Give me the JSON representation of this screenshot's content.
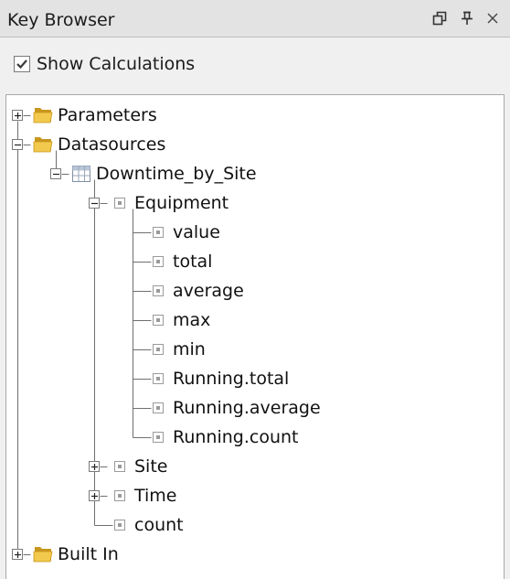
{
  "panel": {
    "title": "Key Browser",
    "controls": [
      "restore-icon",
      "pin-icon",
      "close-icon"
    ]
  },
  "options": {
    "show_calculations_label": "Show Calculations",
    "show_calculations_checked": true
  },
  "tree": [
    {
      "label": "Parameters",
      "depth": 0,
      "kind": "folder",
      "toggle": "plus"
    },
    {
      "label": "Datasources",
      "depth": 0,
      "kind": "folder",
      "toggle": "minus"
    },
    {
      "label": "Downtime_by_Site",
      "depth": 1,
      "kind": "table",
      "toggle": "minus"
    },
    {
      "label": "Equipment",
      "depth": 2,
      "kind": "field",
      "toggle": "minus"
    },
    {
      "label": "value",
      "depth": 3,
      "kind": "field",
      "toggle": "none"
    },
    {
      "label": "total",
      "depth": 3,
      "kind": "field",
      "toggle": "none"
    },
    {
      "label": "average",
      "depth": 3,
      "kind": "field",
      "toggle": "none"
    },
    {
      "label": "max",
      "depth": 3,
      "kind": "field",
      "toggle": "none"
    },
    {
      "label": "min",
      "depth": 3,
      "kind": "field",
      "toggle": "none"
    },
    {
      "label": "Running.total",
      "depth": 3,
      "kind": "field",
      "toggle": "none"
    },
    {
      "label": "Running.average",
      "depth": 3,
      "kind": "field",
      "toggle": "none"
    },
    {
      "label": "Running.count",
      "depth": 3,
      "kind": "field",
      "toggle": "none"
    },
    {
      "label": "Site",
      "depth": 2,
      "kind": "field",
      "toggle": "plus"
    },
    {
      "label": "Time",
      "depth": 2,
      "kind": "field",
      "toggle": "plus"
    },
    {
      "label": "count",
      "depth": 2,
      "kind": "field",
      "toggle": "none"
    },
    {
      "label": "Built In",
      "depth": 0,
      "kind": "folder",
      "toggle": "plus"
    }
  ],
  "colors": {
    "folder": "#f2c94c",
    "folder_dark": "#c9961e",
    "tree_line": "#6f6f6f",
    "field_icon": "#9a9a9a"
  }
}
